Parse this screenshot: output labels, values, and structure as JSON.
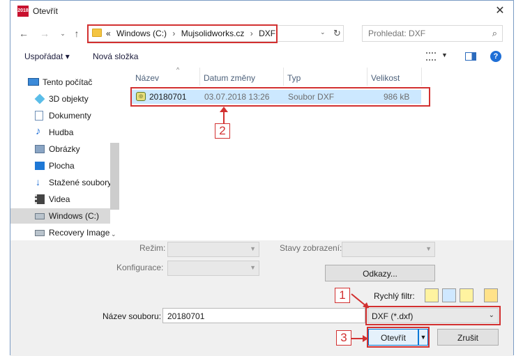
{
  "window": {
    "title": "Otevřít",
    "app_badge": "2018"
  },
  "address": {
    "prefix": "«",
    "segments": [
      "Windows (C:)",
      "Mujsolidworks.cz",
      "DXF"
    ],
    "separator": "›"
  },
  "search": {
    "placeholder": "Prohledat: DXF"
  },
  "toolbar": {
    "organize": "Uspořádat ▾",
    "new_folder": "Nová složka"
  },
  "sidebar": {
    "items": [
      {
        "label": "Tento počítač",
        "icon": "computer-icon"
      },
      {
        "label": "3D objekty",
        "icon": "cube-icon"
      },
      {
        "label": "Dokumenty",
        "icon": "document-icon"
      },
      {
        "label": "Hudba",
        "icon": "music-note-icon"
      },
      {
        "label": "Obrázky",
        "icon": "picture-icon"
      },
      {
        "label": "Plocha",
        "icon": "desktop-icon"
      },
      {
        "label": "Stažené soubory",
        "icon": "download-icon"
      },
      {
        "label": "Videa",
        "icon": "film-icon"
      },
      {
        "label": "Windows (C:)",
        "icon": "drive-icon"
      },
      {
        "label": "Recovery Image",
        "icon": "drive-icon"
      }
    ]
  },
  "list": {
    "columns": [
      "Název",
      "Datum změny",
      "Typ",
      "Velikost"
    ],
    "rows": [
      {
        "name": "20180701",
        "date": "03.07.2018 13:26",
        "type": "Soubor DXF",
        "size": "986 kB"
      }
    ]
  },
  "callouts": [
    "1",
    "2",
    "3"
  ],
  "bottom": {
    "mode_label": "Režim:",
    "config_label": "Konfigurace:",
    "display_states_label": "Stavy zobrazení:",
    "references_button": "Odkazy...",
    "quick_filter_label": "Rychlý filtr:",
    "filename_label": "Název souboru:",
    "filename_value": "20180701",
    "filetype_value": "DXF (*.dxf)",
    "open_button": "Otevřít",
    "cancel_button": "Zrušit"
  },
  "colors": {
    "highlight_red": "#d23030",
    "selection_blue": "#cce8ff",
    "accent_blue": "#1f6fd6"
  }
}
